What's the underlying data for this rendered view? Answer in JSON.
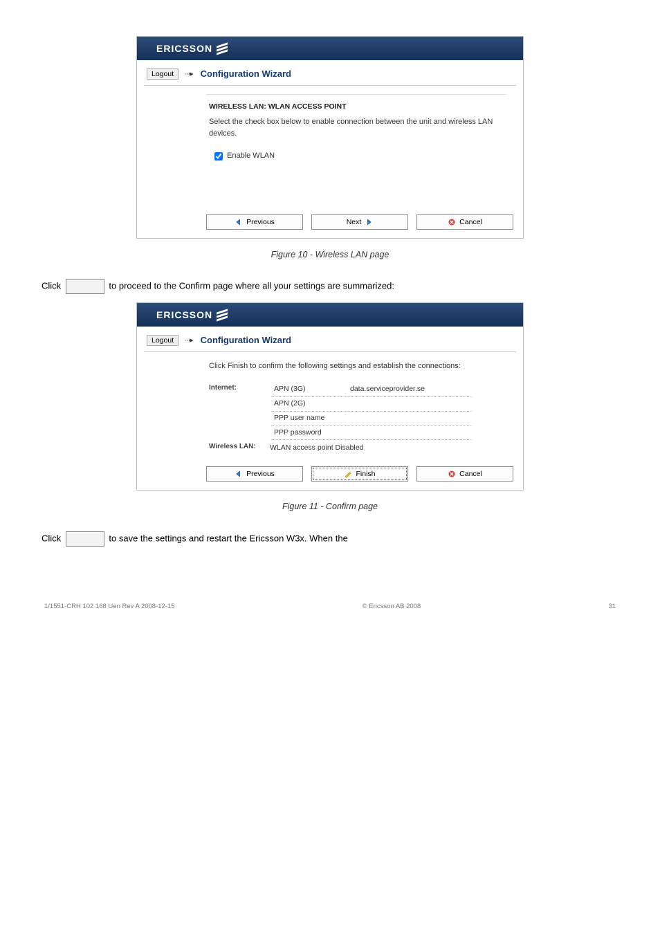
{
  "doc": {
    "footer_left": "1/1551-CRH 102 168 Uen Rev A 2008-12-15",
    "footer_right": "© Ericsson AB 2008",
    "page_no": "31",
    "fig10_caption": "Figure 10 - Wireless LAN page",
    "fig11_caption": "Figure 11 - Confirm page",
    "para1_pre": "Click ",
    "para1_mid": " to proceed to the Confirm page where all your settings are summarized:",
    "para2_pre": "Click ",
    "para2_mid": " to save the settings and restart the Ericsson W3x. When the",
    "next_label": "Next",
    "finish_label": "Finish"
  },
  "app1": {
    "brand": "ERICSSON",
    "logout": "Logout",
    "title": "Configuration Wizard",
    "section": "WIRELESS LAN: WLAN ACCESS POINT",
    "desc": "Select the check box below to enable connection between the unit and wireless LAN devices.",
    "checkbox_label": "Enable WLAN",
    "btn_prev": "Previous",
    "btn_next": "Next",
    "btn_cancel": "Cancel"
  },
  "app2": {
    "brand": "ERICSSON",
    "logout": "Logout",
    "title": "Configuration Wizard",
    "desc": "Click Finish to confirm the following settings and establish the connections:",
    "internet_label": "Internet:",
    "rows": [
      {
        "k": "APN (3G)",
        "v": "data.serviceprovider.se"
      },
      {
        "k": "APN (2G)",
        "v": ""
      },
      {
        "k": "PPP user name",
        "v": ""
      },
      {
        "k": "PPP password",
        "v": ""
      }
    ],
    "wlan_label": "Wireless LAN:",
    "wlan_value": "WLAN access point Disabled",
    "btn_prev": "Previous",
    "btn_finish": "Finish",
    "btn_cancel": "Cancel"
  }
}
